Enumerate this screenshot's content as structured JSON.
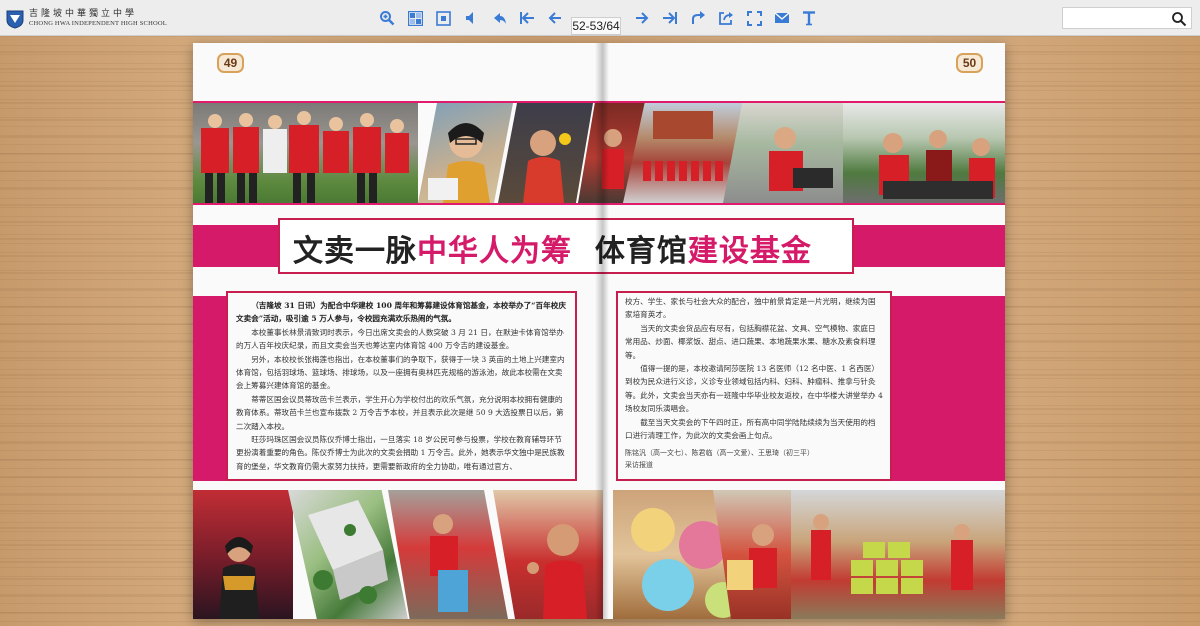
{
  "toolbar": {
    "logo_cn": "吉隆坡中華獨立中學",
    "logo_en": "CHONG HWA INDEPENDENT HIGH SCHOOL",
    "page_indicator": "52-53/64",
    "search_placeholder": "",
    "icons": [
      "zoom-in-icon",
      "thumbnails-icon",
      "fit-page-icon",
      "sound-icon",
      "share-icon",
      "first-page-icon",
      "previous-page-icon",
      "next-page-icon",
      "last-page-icon",
      "forward-icon",
      "export-icon",
      "fullscreen-icon",
      "email-icon",
      "text-icon",
      "search-icon"
    ]
  },
  "book": {
    "left_page_number": "49",
    "right_page_number": "50",
    "title_black_1": "文卖一脉",
    "title_pink_1": "中华人为筹",
    "title_black_2": "体育馆",
    "title_pink_2": "建设基金",
    "article_left": {
      "lead": "（吉隆坡 31 日讯）为配合中华建校 100 周年和筹募建设体育馆基金，本校举办了“百年校庆文卖会”活动，吸引逾 5 万人参与，令校园充满欢乐热闹的气氛。",
      "paragraphs": [
        "本校董事长林景清致词时表示，今日出席文卖会的人数突破 3 月 21 日，在默迪卡体育馆举办的万人百年校庆纪录，而且文卖会当天也筹达室内体育馆 400 万令吉的建设基金。",
        "另外，本校校长张梅莲也指出，在本校董事们的争取下，获得于一块 3 英亩的土地上兴建室内体育馆，包括羽球场、篮球场、排球场，以及一座拥有奥林匹克规格的游泳池，故此本校需在文卖会上筹募兴建体育馆的基金。",
        "蒂蒂区国会议员蒂玫芭卡兰表示，学生开心为学校付出的欢乐气氛，充分说明本校拥有健康的教育体系。蒂玫芭卡兰也宣布拨款 2 万令吉予本校，并且表示此次是继 50 9 大选投票日以后，第二次踏入本校。",
        "旺莎玛珠区国会议员陈仪乔博士指出，一旦落实 18 岁公民可参与投票，学校在教育辅导环节更扮演着重要的角色。陈仪乔博士为此次的文卖会捐助 1 万令吉。此外，她表示华文独中是民族教育的堡垒，华文教育仍需大家努力扶持，更需要新政府的全力协助，唯有通过官方、"
      ]
    },
    "article_right": {
      "paragraphs": [
        "校方、学生、家长与社会大众的配合，独中前景肯定是一片光明，继续为国家培育英才。",
        "当天的文卖会货品应有尽有，包括胸襟花盆、文具、空气模物、家庭日常用品、炒面、椰浆饭、甜点、进口蔬果、本地蔬果水果、糖水及素食料理等。",
        "值得一提的是，本校邀请阿莎医院 13 名医师（12 名中医、1 名西医）到校为民众进行义诊，义诊专业领域包括内科、妇科、肿瘤科、推拿与针灸等。此外，文卖会当天亦有一班隆中华毕业校友返校，在中华楼大讲堂举办 4 场校友同乐演唱会。",
        "截至当天文卖会的下午四时正，所有高中同学陆陆续续为当天使用的档口进行清理工作，为此次的文卖会画上句点。"
      ],
      "credit_1": "陈铭汎（高一文七）、陈君临（高一文爱）、王思琦（初三平）",
      "credit_2": "采访报道"
    }
  },
  "colors": {
    "accent_pink": "#d41a68",
    "border_red": "#c81e4f",
    "toolbar_icon_blue": "#3a7bd5",
    "page_badge_border": "#d9a25b"
  }
}
